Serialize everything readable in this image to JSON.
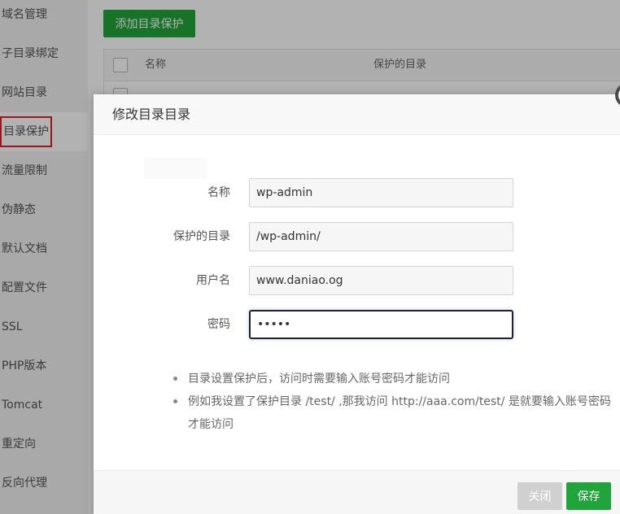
{
  "sidebar": {
    "items": [
      {
        "label": "域名管理"
      },
      {
        "label": "子目录绑定"
      },
      {
        "label": "网站目录"
      },
      {
        "label": "目录保护"
      },
      {
        "label": "流量限制"
      },
      {
        "label": "伪静态"
      },
      {
        "label": "默认文档"
      },
      {
        "label": "配置文件"
      },
      {
        "label": "SSL"
      },
      {
        "label": "PHP版本"
      },
      {
        "label": "Tomcat"
      },
      {
        "label": "重定向"
      },
      {
        "label": "反向代理"
      }
    ],
    "active_index": 3
  },
  "main": {
    "add_button_label": "添加目录保护",
    "table": {
      "headers": [
        "名称",
        "保护的目录"
      ]
    }
  },
  "modal": {
    "title": "修改目录目录",
    "fields": [
      {
        "label": "名称",
        "value": "wp-admin"
      },
      {
        "label": "保护的目录",
        "value": "/wp-admin/"
      },
      {
        "label": "用户名",
        "value": "www.daniao.og"
      },
      {
        "label": "密码",
        "value": "•••••"
      }
    ],
    "tips": [
      "目录设置保护后，访问时需要输入账号密码才能访问",
      "例如我设置了保护目录 /test/ ,那我访问 http://aaa.com/test/ 是就要输入账号密码才能访问"
    ],
    "buttons": {
      "cancel": "关闭",
      "save": "保存"
    }
  },
  "colors": {
    "accent": "#20a53a",
    "highlight_border": "#e0202a",
    "overlay": "rgba(0,0,0,0.30)"
  }
}
